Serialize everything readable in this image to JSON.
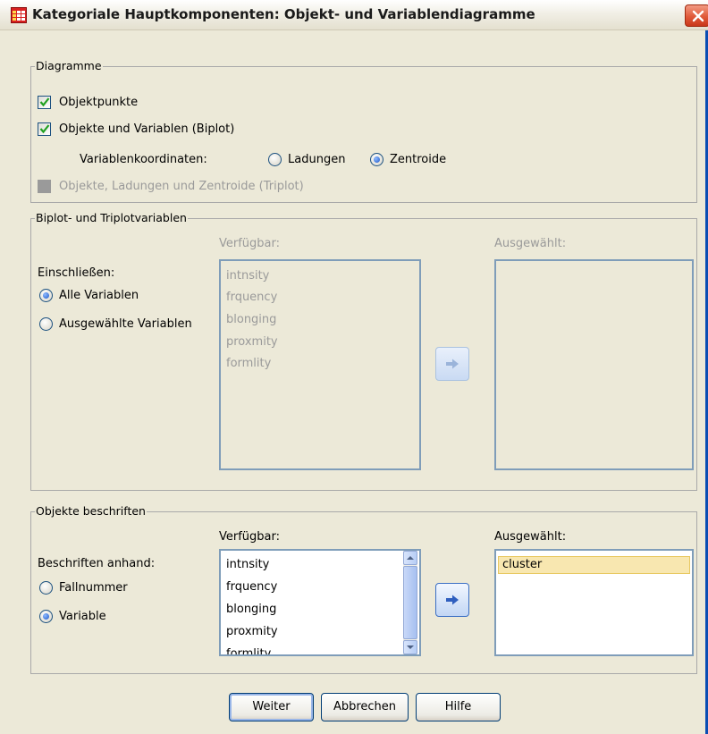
{
  "window": {
    "title": "Kategoriale Hauptkomponenten: Objekt- und Variablendiagramme"
  },
  "diagramme": {
    "group_label": "Diagramme",
    "objektpunkte": "Objektpunkte",
    "biplot": "Objekte und Variablen (Biplot)",
    "variablenkoordinaten": "Variablenkoordinaten:",
    "ladungen": "Ladungen",
    "zentroide": "Zentroide",
    "triplot": "Objekte, Ladungen und Zentroide (Triplot)"
  },
  "biplot_vars": {
    "group_label": "Biplot- und Triplotvariablen",
    "verfuegbar": "Verfügbar:",
    "ausgewaehlt": "Ausgewählt:",
    "einschliessen": "Einschließen:",
    "alle": "Alle Variablen",
    "ausgewaehlte": "Ausgewählte Variablen",
    "available_items": [
      "intnsity",
      "frquency",
      "blonging",
      "proxmity",
      "formlity"
    ]
  },
  "objekte": {
    "group_label": "Objekte beschriften",
    "verfuegbar": "Verfügbar:",
    "ausgewaehlt": "Ausgewählt:",
    "beschriften_anhand": "Beschriften anhand:",
    "fallnummer": "Fallnummer",
    "variable": "Variable",
    "available_items": [
      "intnsity",
      "frquency",
      "blonging",
      "proxmity",
      "formlity"
    ],
    "selected_items": [
      "cluster"
    ]
  },
  "buttons": {
    "weiter": "Weiter",
    "abbrechen": "Abbrechen",
    "hilfe": "Hilfe"
  },
  "colors": {
    "dialog_bg": "#ece9d8",
    "list_border": "#7f9db9",
    "selection": "#f8e7b0",
    "close_red": "#e05a3a"
  }
}
